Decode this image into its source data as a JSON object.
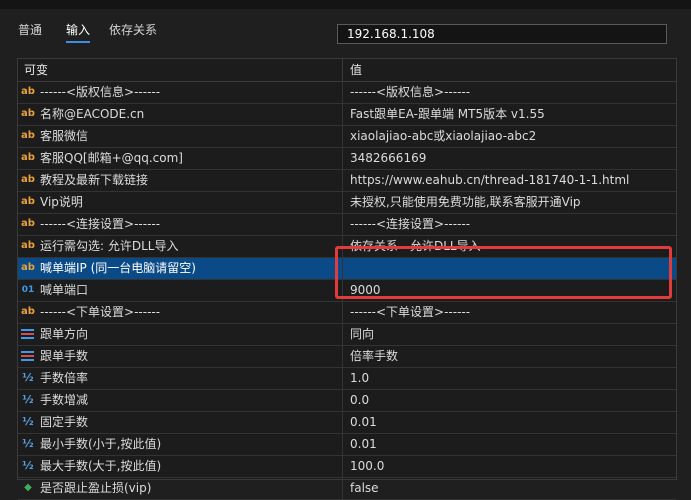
{
  "tabs": [
    {
      "label": "普通",
      "active": false
    },
    {
      "label": "输入",
      "active": true
    },
    {
      "label": "依存关系",
      "active": false
    }
  ],
  "table": {
    "columns": [
      "可变",
      "值"
    ],
    "rows": [
      {
        "icon": "ab",
        "name": "------<版权信息>------",
        "value": "------<版权信息>------"
      },
      {
        "icon": "ab",
        "name": "名称@EACODE.cn",
        "value": "Fast跟单EA-跟单端 MT5版本 v1.55"
      },
      {
        "icon": "ab",
        "name": "客服微信",
        "value": "xiaolajiao-abc或xiaolajiao-abc2"
      },
      {
        "icon": "ab",
        "name": "客服QQ[邮箱+@qq.com]",
        "value": "3482666169"
      },
      {
        "icon": "ab",
        "name": "教程及最新下载链接",
        "value": "https://www.eahub.cn/thread-181740-1-1.html"
      },
      {
        "icon": "ab",
        "name": "Vip说明",
        "value": "未授权,只能使用免费功能,联系客服开通Vip"
      },
      {
        "icon": "ab",
        "name": "------<连接设置>------",
        "value": "------<连接设置>------"
      },
      {
        "icon": "ab",
        "name": "运行需勾选: 允许DLL导入",
        "value": "依存关系 - 允许DLL导入"
      },
      {
        "icon": "ab",
        "name": "喊单端IP (同一台电脑请留空)",
        "value": "192.168.1.108",
        "selected": true,
        "editing": true
      },
      {
        "icon": "01",
        "name": "喊单端口",
        "value": "9000"
      },
      {
        "icon": "ab",
        "name": "------<下单设置>------",
        "value": "------<下单设置>------"
      },
      {
        "icon": "enum",
        "name": "跟单方向",
        "value": "同向"
      },
      {
        "icon": "enum",
        "name": "跟单手数",
        "value": "倍率手数"
      },
      {
        "icon": "half",
        "name": "手数倍率",
        "value": "1.0"
      },
      {
        "icon": "half",
        "name": "手数增减",
        "value": "0.0"
      },
      {
        "icon": "half",
        "name": "固定手数",
        "value": "0.01"
      },
      {
        "icon": "half",
        "name": "最小手数(小于,按此值)",
        "value": "0.01"
      },
      {
        "icon": "half",
        "name": "最大手数(大于,按此值)",
        "value": "100.0"
      },
      {
        "icon": "bool",
        "name": "是否跟止盈止损(vip)",
        "value": "false"
      }
    ]
  },
  "colors": {
    "accent": "#3c8ee6",
    "selected_row": "#0a4a86",
    "highlight_box": "#e13c3c",
    "string_icon": "#e8a33a"
  }
}
